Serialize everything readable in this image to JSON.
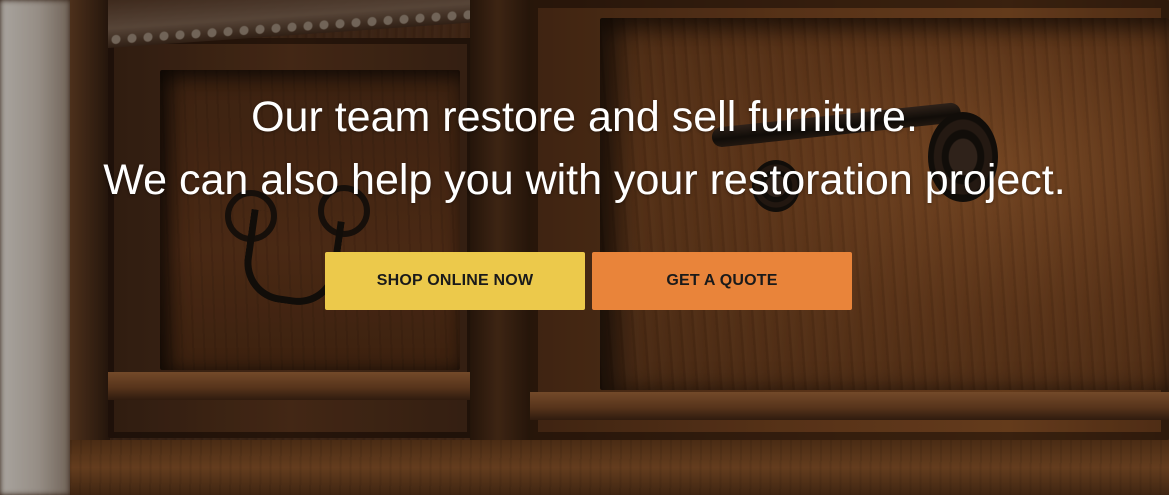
{
  "hero": {
    "headline_line_1": "Our team restore and sell furniture.",
    "headline_line_2": "We can also help you with your restoration project."
  },
  "actions": {
    "shop_online_label": "SHOP ONLINE NOW",
    "get_quote_label": "GET A QUOTE"
  },
  "colors": {
    "shop_button_bg": "#ecc94b",
    "quote_button_bg": "#e9843a",
    "headline_text": "#ffffff",
    "button_text": "#1a1a1a"
  },
  "background": {
    "subject": "wooden dresser drawers with dark metal handles"
  }
}
